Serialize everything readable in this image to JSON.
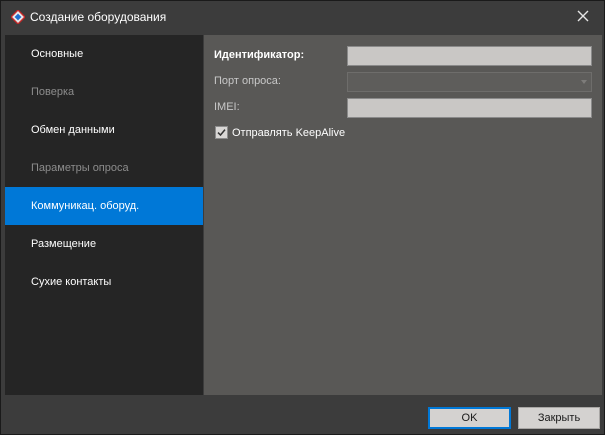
{
  "window": {
    "title": "Создание оборудования",
    "close_icon": "close-icon",
    "app_icon": "app-logo-icon"
  },
  "sidebar": {
    "items": [
      {
        "label": "Основные",
        "state": "normal"
      },
      {
        "label": "Поверка",
        "state": "disabled"
      },
      {
        "label": "Обмен данными",
        "state": "normal"
      },
      {
        "label": "Параметры опроса",
        "state": "disabled"
      },
      {
        "label": "Коммуникац. оборуд.",
        "state": "selected"
      },
      {
        "label": "Размещение",
        "state": "normal"
      },
      {
        "label": "Сухие контакты",
        "state": "normal"
      }
    ]
  },
  "form": {
    "identifier_label": "Идентификатор:",
    "identifier_value": "",
    "port_label": "Порт опроса:",
    "port_value": "",
    "imei_label": "IMEI:",
    "imei_value": "",
    "keepalive_label": "Отправлять KeepAlive",
    "keepalive_checked": true
  },
  "footer": {
    "ok_label": "OK",
    "close_label": "Закрыть"
  },
  "colors": {
    "accent": "#0078d7",
    "sidebar_bg": "#252525",
    "content_bg": "#595856",
    "window_bg": "#3c3c3c"
  }
}
